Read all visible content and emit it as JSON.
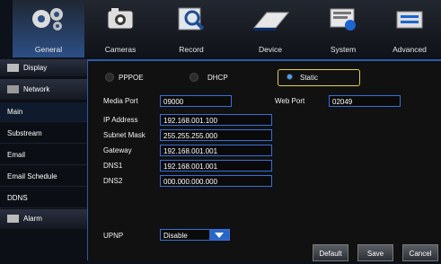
{
  "topnav": {
    "tabs": [
      {
        "label": "General",
        "icon": "gears-icon",
        "active": true
      },
      {
        "label": "Cameras",
        "icon": "camera-icon",
        "active": false
      },
      {
        "label": "Record",
        "icon": "record-icon",
        "active": false
      },
      {
        "label": "Device",
        "icon": "device-icon",
        "active": false
      },
      {
        "label": "System",
        "icon": "system-icon",
        "active": false
      },
      {
        "label": "Advanced",
        "icon": "advanced-icon",
        "active": false
      }
    ]
  },
  "sidebar": {
    "display": "Display",
    "network": "Network",
    "main": "Main",
    "substream": "Substream",
    "email": "Email",
    "email_schedule": "Email Schedule",
    "ddns": "DDNS",
    "alarm": "Alarm"
  },
  "network": {
    "mode_options": [
      "PPPOE",
      "DHCP",
      "Static"
    ],
    "selected_mode": "Static",
    "media_port_label": "Media Port",
    "media_port": "09000",
    "web_port_label": "Web Port",
    "web_port": "02049",
    "ip_label": "IP Address",
    "ip": "192.168.001.100",
    "subnet_label": "Subnet Mask",
    "subnet": "255.255.255.000",
    "gateway_label": "Gateway",
    "gateway": "192.168.001.001",
    "dns1_label": "DNS1",
    "dns1": "192.168.001.001",
    "dns2_label": "DNS2",
    "dns2": "000.000.000.000",
    "upnp_label": "UPNP",
    "upnp": "Disable"
  },
  "buttons": {
    "default": "Default",
    "save": "Save",
    "cancel": "Cancel"
  }
}
